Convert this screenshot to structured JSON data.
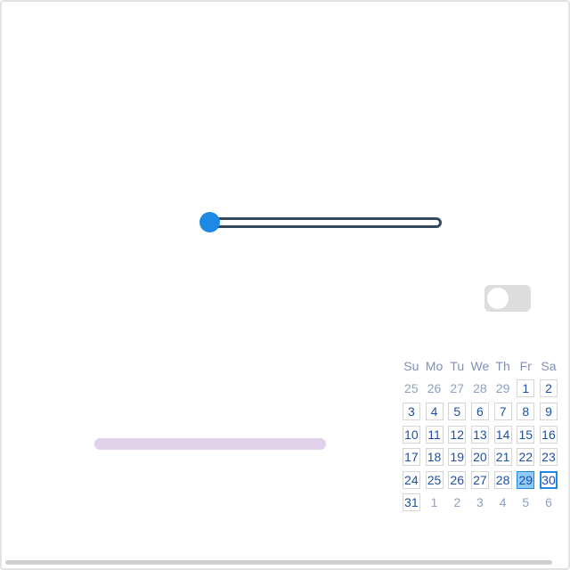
{
  "slider": {
    "value_fraction": 0.0
  },
  "toggle": {
    "checked": false
  },
  "progress": {
    "value_percent": 0
  },
  "calendar": {
    "weekdays": [
      "Su",
      "Mo",
      "Tu",
      "We",
      "Th",
      "Fr",
      "Sa"
    ],
    "weeks": [
      [
        {
          "d": "25",
          "out": true
        },
        {
          "d": "26",
          "out": true
        },
        {
          "d": "27",
          "out": true
        },
        {
          "d": "28",
          "out": true
        },
        {
          "d": "29",
          "out": true
        },
        {
          "d": "1"
        },
        {
          "d": "2"
        }
      ],
      [
        {
          "d": "3"
        },
        {
          "d": "4"
        },
        {
          "d": "5"
        },
        {
          "d": "6"
        },
        {
          "d": "7"
        },
        {
          "d": "8"
        },
        {
          "d": "9"
        }
      ],
      [
        {
          "d": "10"
        },
        {
          "d": "11"
        },
        {
          "d": "12"
        },
        {
          "d": "13"
        },
        {
          "d": "14"
        },
        {
          "d": "15"
        },
        {
          "d": "16"
        }
      ],
      [
        {
          "d": "17"
        },
        {
          "d": "18"
        },
        {
          "d": "19"
        },
        {
          "d": "20"
        },
        {
          "d": "21"
        },
        {
          "d": "22"
        },
        {
          "d": "23"
        }
      ],
      [
        {
          "d": "24"
        },
        {
          "d": "25"
        },
        {
          "d": "26"
        },
        {
          "d": "27"
        },
        {
          "d": "28"
        },
        {
          "d": "29",
          "selected": true
        },
        {
          "d": "30",
          "today": true
        }
      ],
      [
        {
          "d": "31"
        },
        {
          "d": "1",
          "out": true
        },
        {
          "d": "2",
          "out": true
        },
        {
          "d": "3",
          "out": true
        },
        {
          "d": "4",
          "out": true
        },
        {
          "d": "5",
          "out": true
        },
        {
          "d": "6",
          "out": true
        }
      ]
    ]
  },
  "colors": {
    "accent": "#1e88e5",
    "slider_track": "#34495e",
    "toggle_off": "#dddddd",
    "progress_track": "#e1d1ea",
    "calendar_text": "#1f4fa5",
    "calendar_muted": "#8fa0c2",
    "calendar_selected": "#90caf9"
  }
}
